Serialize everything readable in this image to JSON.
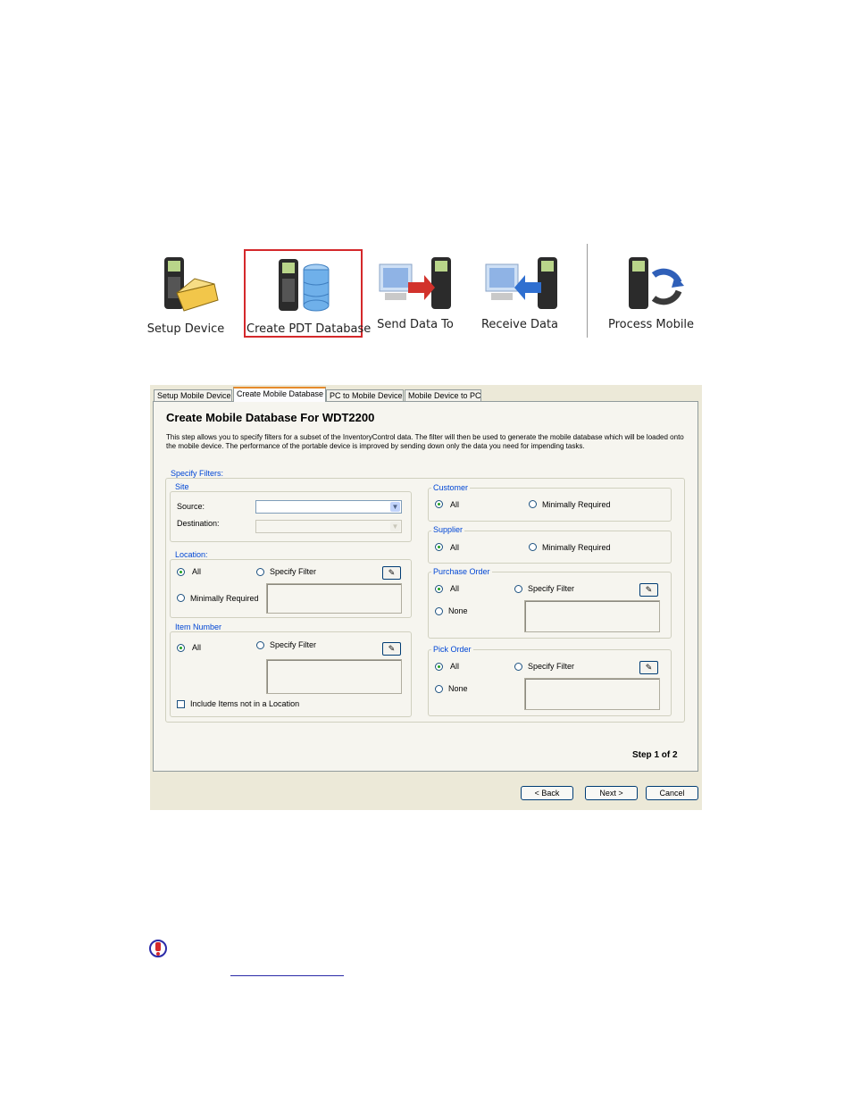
{
  "toolbar": {
    "items": [
      {
        "label": "Setup Device",
        "icon": "device-toolbox-icon"
      },
      {
        "label": "Create PDT Database",
        "icon": "device-database-icon",
        "selected": true
      },
      {
        "label": "Send Data To",
        "icon": "pc-to-device-icon"
      },
      {
        "label": "Receive Data",
        "icon": "device-to-pc-icon"
      },
      {
        "label": "Process Mobile",
        "icon": "device-sync-icon"
      }
    ],
    "highlight_color": "#d4282b"
  },
  "wizard": {
    "tabs": [
      "Setup Mobile Device",
      "Create Mobile Database",
      "PC to Mobile Device",
      "Mobile Device to PC"
    ],
    "active_tab": "Create Mobile Database",
    "title": "Create Mobile Database For WDT2200",
    "description": "This step allows you to specify filters for a subset of the InventoryControl data. The filter will then be used to generate the mobile database which will be loaded onto the mobile device. The performance of the portable device is improved by sending down only the data you need for impending tasks.",
    "filters_label": "Specify Filters:",
    "site": {
      "label": "Site",
      "source_label": "Source:",
      "source_value": "",
      "destination_label": "Destination:",
      "destination_value": ""
    },
    "location": {
      "label": "Location:",
      "all": "All",
      "specify_filter": "Specify Filter",
      "minimally_required": "Minimally Required",
      "selected": "All"
    },
    "item_number": {
      "label": "Item Number",
      "all": "All",
      "specify_filter": "Specify Filter",
      "include_label": "Include Items not in a Location",
      "include_checked": false,
      "selected": "All"
    },
    "customer": {
      "label": "Customer",
      "all": "All",
      "minimally_required": "Minimally Required",
      "selected": "All"
    },
    "supplier": {
      "label": "Supplier",
      "all": "All",
      "minimally_required": "Minimally Required",
      "selected": "All"
    },
    "purchase_order": {
      "label": "Purchase Order",
      "all": "All",
      "specify_filter": "Specify Filter",
      "none": "None",
      "selected": "All"
    },
    "pick_order": {
      "label": "Pick Order",
      "all": "All",
      "specify_filter": "Specify Filter",
      "none": "None",
      "selected": "All"
    },
    "step_text": "Step  1  of  2",
    "buttons": {
      "back": "< Back",
      "next": "Next >",
      "cancel": "Cancel"
    }
  },
  "footer": {
    "warning_icon": "important-info-icon"
  }
}
